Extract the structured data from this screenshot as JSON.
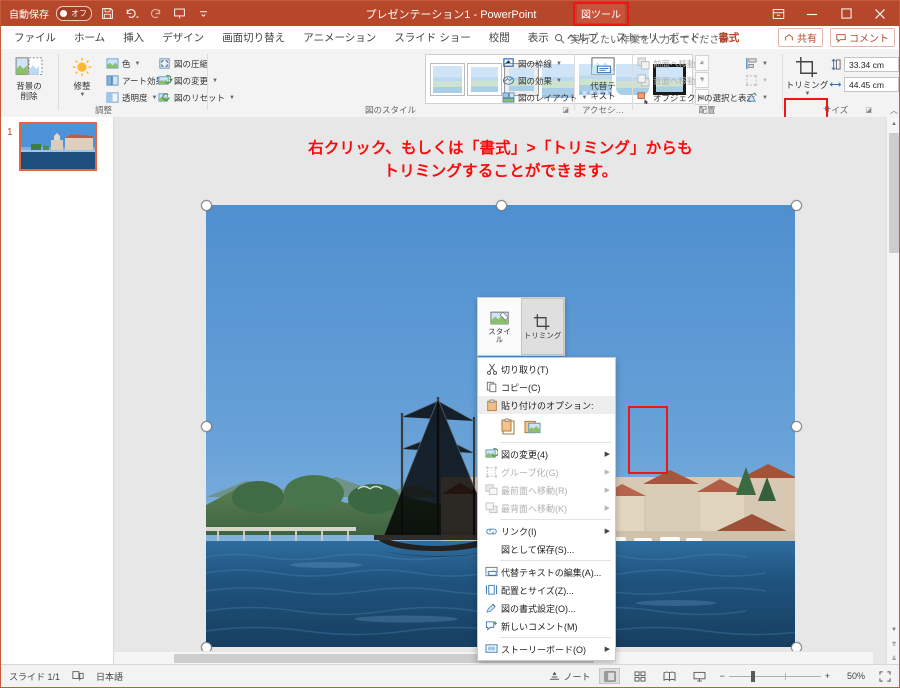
{
  "titlebar": {
    "autosave_label": "自動保存",
    "toggle_state": "オフ",
    "document_title": "プレゼンテーション1  -  PowerPoint",
    "picture_tools_chip": "図ツール",
    "icons": [
      "save-icon",
      "undo-icon",
      "redo-icon",
      "present-icon",
      "more-icon"
    ],
    "window_buttons": [
      "ribbon-display-options",
      "minimize",
      "maximize",
      "close"
    ]
  },
  "tabs": [
    {
      "label": "ファイル",
      "accent": false
    },
    {
      "label": "ホーム",
      "accent": false
    },
    {
      "label": "挿入",
      "accent": false
    },
    {
      "label": "デザイン",
      "accent": false
    },
    {
      "label": "画面切り替え",
      "accent": false
    },
    {
      "label": "アニメーション",
      "accent": false
    },
    {
      "label": "スライド ショー",
      "accent": false
    },
    {
      "label": "校閲",
      "accent": false
    },
    {
      "label": "表示",
      "accent": false
    },
    {
      "label": "ヘルプ",
      "accent": false
    },
    {
      "label": "ストーリーボード",
      "accent": false
    },
    {
      "label": "書式",
      "accent": true
    }
  ],
  "search": {
    "placeholder": "実行したい作業を入力してください"
  },
  "share": {
    "share_label": "共有",
    "comment_label": "コメント"
  },
  "ribbon": {
    "groups": [
      {
        "name": "調整",
        "label": "調整",
        "remove_bg": "背景の\n削除",
        "remove_bg_line1": "背景の",
        "remove_bg_line2": "削除",
        "corrections": "修整",
        "items": [
          {
            "label": "色",
            "caret": true,
            "disabled": false
          },
          {
            "label": "アート効果",
            "caret": true,
            "disabled": false
          },
          {
            "label": "透明度",
            "caret": true,
            "disabled": false
          },
          {
            "label": "図の圧縮",
            "caret": false,
            "disabled": false
          },
          {
            "label": "図の変更",
            "caret": true,
            "disabled": false
          },
          {
            "label": "図のリセット",
            "caret": true,
            "disabled": false
          }
        ]
      },
      {
        "name": "図のスタイル",
        "label": "図のスタイル",
        "items": [
          {
            "label": "図の枠線",
            "caret": true,
            "disabled": false
          },
          {
            "label": "図の効果",
            "caret": true,
            "disabled": false
          },
          {
            "label": "図のレイアウト",
            "caret": true,
            "disabled": false
          }
        ]
      },
      {
        "name": "アクセシビリティ",
        "label": "アクセシ…",
        "alt_text_line1": "代替テ",
        "alt_text_line2": "キスト"
      },
      {
        "name": "配置",
        "label": "配置",
        "items": [
          {
            "label": "前面へ移動",
            "caret": true,
            "disabled": true
          },
          {
            "label": "背面へ移動",
            "caret": true,
            "disabled": true
          },
          {
            "label": "オブジェクトの選択と表示",
            "caret": false,
            "disabled": false
          }
        ]
      },
      {
        "name": "サイズ",
        "label": "サイズ",
        "crop_label": "トリミング",
        "height_value": "33.34 cm",
        "width_value": "44.45 cm"
      }
    ]
  },
  "annotation": {
    "line1": "右クリック、もしくは「書式」>「トリミング」からも",
    "line2": "トリミングすることができます。"
  },
  "slide_panel": {
    "slide_number": "1"
  },
  "minibar": {
    "items": [
      {
        "label_line1": "スタイ",
        "label_line2": "ル",
        "icon": "picture-styles-icon",
        "selected": false
      },
      {
        "label_line1": "トリミング",
        "label_line2": "",
        "icon": "crop-icon",
        "selected": true
      }
    ]
  },
  "context_menu": [
    {
      "label": "切り取り(T)",
      "icon": "cut-icon",
      "disabled": false,
      "submenu": false,
      "highlight": false
    },
    {
      "label": "コピー(C)",
      "icon": "copy-icon",
      "disabled": false,
      "submenu": false,
      "highlight": false
    },
    {
      "label": "貼り付けのオプション:",
      "icon": "paste-icon",
      "disabled": false,
      "submenu": false,
      "highlight": true
    },
    {
      "label": "図の変更(4)",
      "icon": "change-picture-icon",
      "disabled": false,
      "submenu": true,
      "highlight": false
    },
    {
      "label": "グループ化(G)",
      "icon": "group-icon",
      "disabled": true,
      "submenu": true,
      "highlight": false
    },
    {
      "label": "最前面へ移動(R)",
      "icon": "bring-front-icon",
      "disabled": true,
      "submenu": true,
      "highlight": false
    },
    {
      "label": "最背面へ移動(K)",
      "icon": "send-back-icon",
      "disabled": true,
      "submenu": true,
      "highlight": false
    },
    {
      "label": "リンク(I)",
      "icon": "link-icon",
      "disabled": false,
      "submenu": true,
      "highlight": false
    },
    {
      "label": "図として保存(S)...",
      "icon": "save-picture-icon",
      "disabled": false,
      "submenu": false,
      "highlight": false
    },
    {
      "label": "代替テキストの編集(A)...",
      "icon": "alt-text-icon",
      "disabled": false,
      "submenu": false,
      "highlight": false
    },
    {
      "label": "配置とサイズ(Z)...",
      "icon": "size-position-icon",
      "disabled": false,
      "submenu": false,
      "highlight": false
    },
    {
      "label": "図の書式設定(O)...",
      "icon": "format-picture-icon",
      "disabled": false,
      "submenu": false,
      "highlight": false
    },
    {
      "label": "新しいコメント(M)",
      "icon": "new-comment-icon",
      "disabled": false,
      "submenu": false,
      "highlight": false
    },
    {
      "label": "ストーリーボード(O)",
      "icon": "storyboard-icon",
      "disabled": false,
      "submenu": true,
      "highlight": false
    }
  ],
  "statusbar": {
    "slide_indicator": "スライド 1/1",
    "language": "日本語",
    "notes_label": "ノート",
    "zoom_level": "50%",
    "view_buttons": [
      "normal-view",
      "slide-sorter-view",
      "reading-view",
      "slideshow-view"
    ]
  },
  "colors": {
    "brand": "#b7472a",
    "annotation_red": "#fa0a0a",
    "highlight_red": "#f01414",
    "selection_orange": "#e8633a"
  }
}
